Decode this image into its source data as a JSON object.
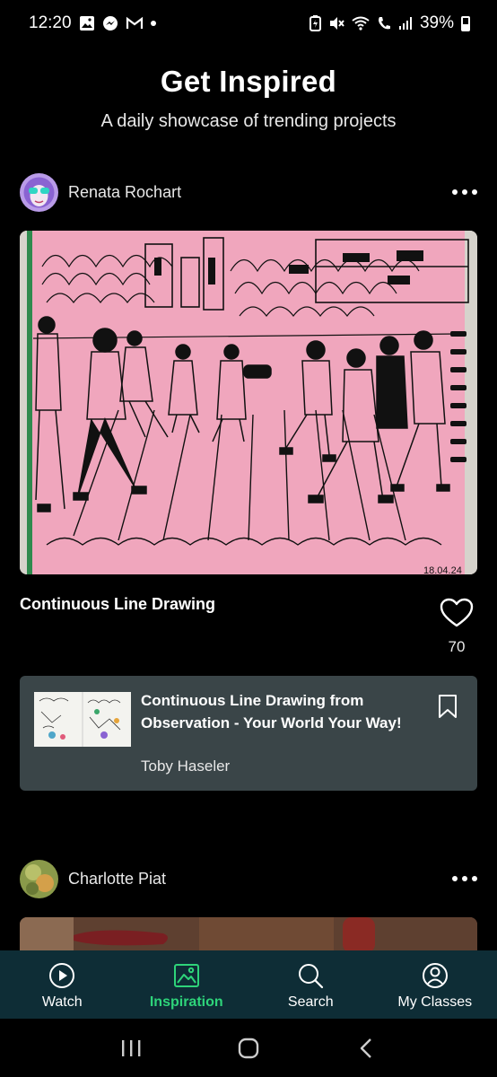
{
  "status_bar": {
    "time": "12:20",
    "battery": "39%"
  },
  "header": {
    "title": "Get Inspired",
    "subtitle": "A daily showcase of trending projects"
  },
  "posts": [
    {
      "author": "Renata Rochart",
      "title": "Continuous Line Drawing",
      "likes": "70",
      "image_date": "18.04.24",
      "class": {
        "title": "Continuous Line Drawing from Observation - Your World Your Way!",
        "teacher": "Toby Haseler"
      }
    },
    {
      "author": "Charlotte Piat"
    }
  ],
  "nav": [
    {
      "label": "Watch",
      "icon": "play-icon",
      "active": false
    },
    {
      "label": "Inspiration",
      "icon": "image-icon",
      "active": true
    },
    {
      "label": "Search",
      "icon": "search-icon",
      "active": false
    },
    {
      "label": "My Classes",
      "icon": "profile-icon",
      "active": false
    }
  ],
  "colors": {
    "accent": "#2ed47a",
    "nav_bg": "#0e2d36",
    "card_bg": "#3a4548",
    "artwork_paper": "#f0a6bd"
  }
}
